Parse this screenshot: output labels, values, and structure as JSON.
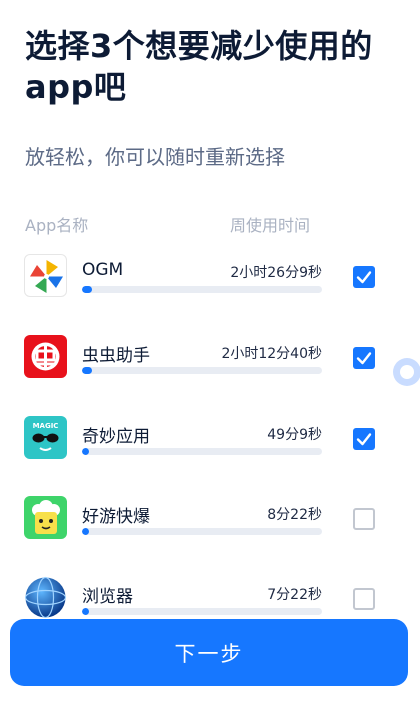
{
  "header": {
    "title": "选择3个想要减少使用的app吧",
    "subtitle": "放轻松，你可以随时重新选择"
  },
  "columns": {
    "app": "App名称",
    "time": "周使用时间"
  },
  "apps": [
    {
      "name": "OGM",
      "time": "2小时26分9秒",
      "usage_fraction": 0.04,
      "checked": true,
      "icon": "pinwheel-icon"
    },
    {
      "name": "虫虫助手",
      "time": "2小时12分40秒",
      "usage_fraction": 0.04,
      "checked": true,
      "icon": "bug-assistant-icon"
    },
    {
      "name": "奇妙应用",
      "time": "49分9秒",
      "usage_fraction": 0.03,
      "checked": true,
      "icon": "magic-sunglasses-icon"
    },
    {
      "name": "好游快爆",
      "time": "8分22秒",
      "usage_fraction": 0.03,
      "checked": false,
      "icon": "game-popcorn-icon"
    },
    {
      "name": "浏览器",
      "time": "7分22秒",
      "usage_fraction": 0.03,
      "checked": false,
      "icon": "globe-browser-icon"
    }
  ],
  "footer": {
    "next_label": "下一步"
  },
  "colors": {
    "accent": "#1677ff",
    "bar_track": "#e8ecf3",
    "text": "#0d1b35"
  }
}
